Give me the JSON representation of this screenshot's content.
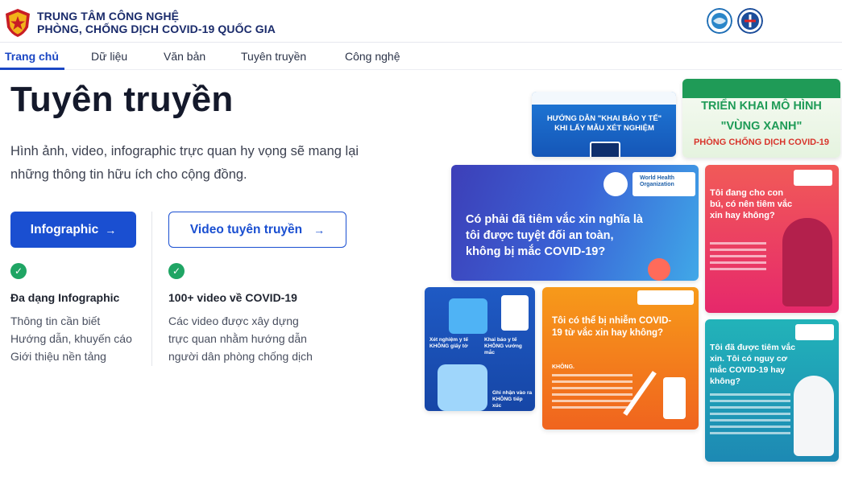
{
  "header": {
    "org_line1": "TRUNG TÂM CÔNG NGHỆ",
    "org_line2": "PHÒNG, CHỐNG DỊCH COVID-19 QUỐC GIA",
    "logo_icon": "shield-star-logo",
    "partners": [
      "ministry-ict-emblem",
      "ministry-health-emblem"
    ]
  },
  "nav": {
    "items": [
      "Trang chủ",
      "Dữ liệu",
      "Văn bản",
      "Tuyên truyền",
      "Công nghệ"
    ],
    "active_index": 0,
    "accent": "#1b47c4"
  },
  "hero": {
    "title": "Tuyên truyền",
    "description": "Hình ảnh, video, infographic trực quan hy vọng sẽ mang lại những thông tin hữu ích cho cộng đồng."
  },
  "buttons": {
    "infographic": "Infographic",
    "video": "Video tuyên truyền",
    "arrow": "→"
  },
  "features": [
    {
      "title": "Đa dạng Infographic",
      "lines": [
        "Thông tin cần biết",
        "Hướng dẫn, khuyến cáo",
        "Giới thiệu nền tảng"
      ]
    },
    {
      "title": "100+ video về COVID-19",
      "lines": [
        "Các video được xây dựng",
        "trực quan nhằm hướng dẫn",
        "người dân phòng chống dịch"
      ]
    }
  ],
  "cards": {
    "khai_bao": "HƯỚNG DẪN \"KHAI BÁO Y TẾ\" KHI LẤY MẪU XÉT NGHIỆM",
    "vung_xanh_1": "TRIỂN KHAI MÔ HÌNH",
    "vung_xanh_2": "\"VÙNG XANH\"",
    "vung_xanh_3": "PHÒNG CHỐNG DỊCH COVID-19",
    "vaccine_safe": "Có phải đã tiêm vắc xin nghĩa là tôi được tuyệt đối an toàn, không bị mắc COVID-19?",
    "breastfeed": "Tôi đang cho con bú, có nên tiêm vắc xin hay không?",
    "who_name": "World Health Organization",
    "infect": "Tôi có thể bị nhiễm COVID-19 từ vắc xin hay không?",
    "vaccinated": "Tôi đã được tiêm vắc xin. Tôi có nguy cơ mắc COVID-19 hay không?",
    "test_label_1": "Xét nghiệm y tế KHÔNG giấy tờ",
    "test_label_2": "Khai báo y tế KHÔNG vướng mắc",
    "test_label_3": "Ghi nhận vào ra KHÔNG tiếp xúc",
    "khong": "KHÔNG."
  }
}
